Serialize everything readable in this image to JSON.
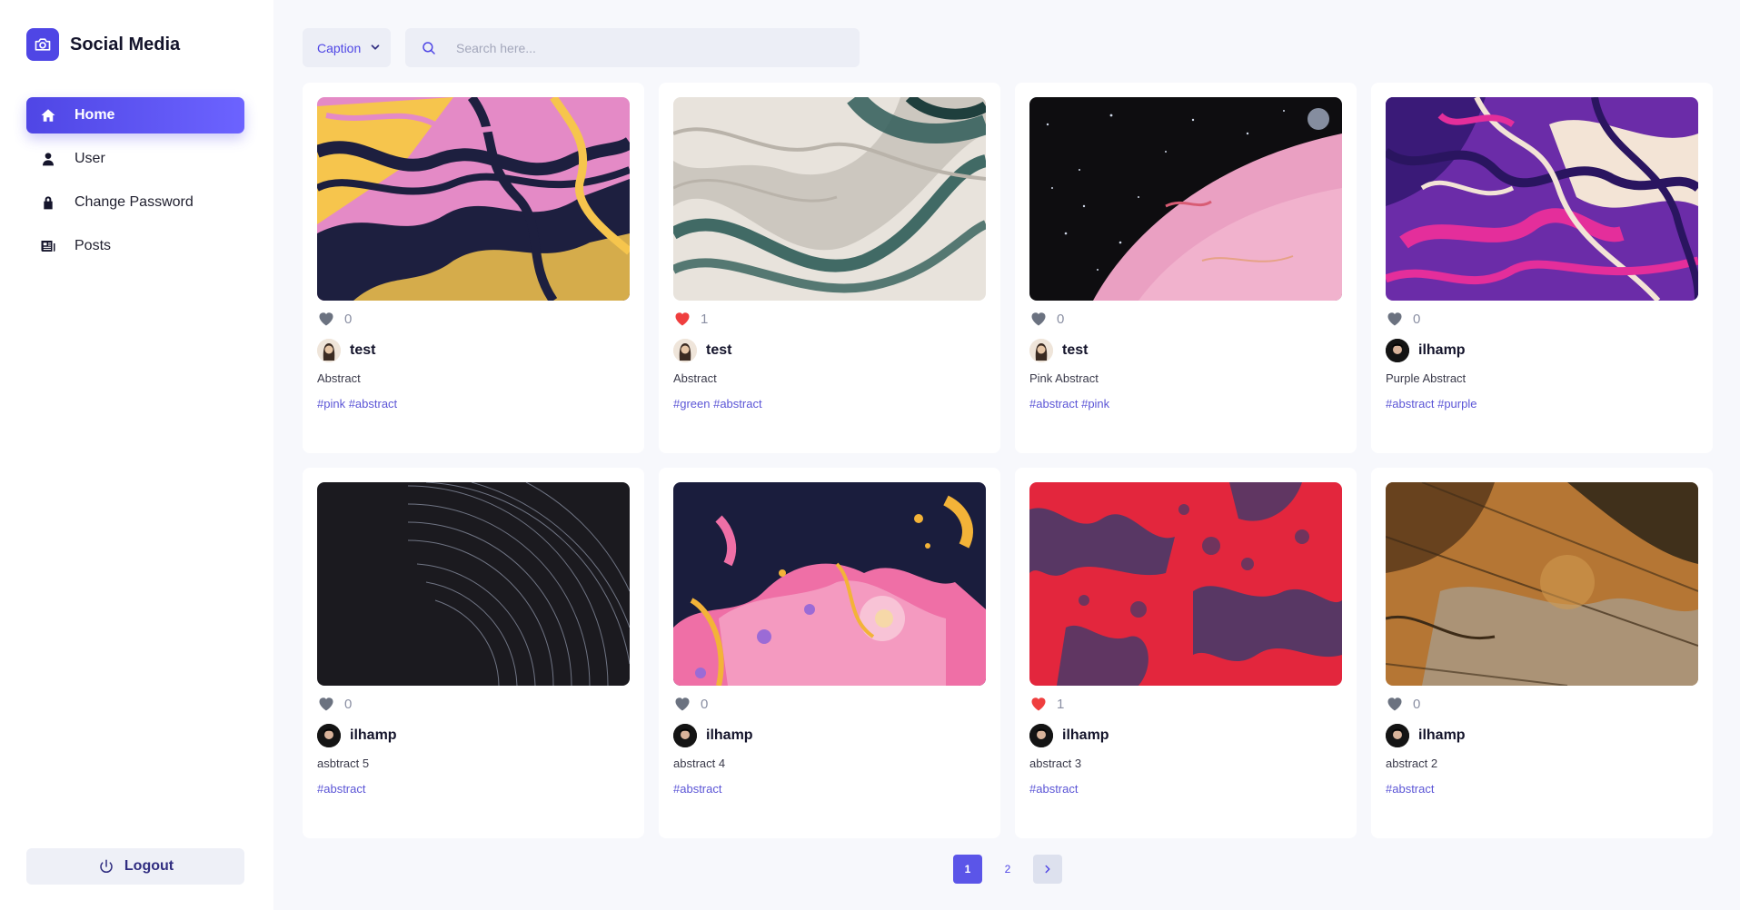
{
  "app": {
    "name": "Social Media",
    "accent": "#4f46e5",
    "logo_icon": "camera-icon"
  },
  "sidebar": {
    "items": [
      {
        "label": "Home",
        "icon": "home-icon",
        "active": true
      },
      {
        "label": "User",
        "icon": "user-icon",
        "active": false
      },
      {
        "label": "Change Password",
        "icon": "lock-icon",
        "active": false
      },
      {
        "label": "Posts",
        "icon": "newspaper-icon",
        "active": false
      }
    ],
    "logout_label": "Logout"
  },
  "toolbar": {
    "filter_selected": "Caption",
    "search_placeholder": "Search here..."
  },
  "posts": [
    {
      "likes": "0",
      "liked": false,
      "author": "test",
      "caption": "Abstract",
      "tags": "#pink #abstract",
      "image": "pink-yellow-marble"
    },
    {
      "likes": "1",
      "liked": true,
      "author": "test",
      "caption": "Abstract",
      "tags": "#green #abstract",
      "image": "green-white-waves"
    },
    {
      "likes": "0",
      "liked": false,
      "author": "test",
      "caption": "Pink Abstract",
      "tags": "#abstract #pink",
      "image": "pink-planet-space"
    },
    {
      "likes": "0",
      "liked": false,
      "author": "ilhamp",
      "caption": "Purple Abstract",
      "tags": "#abstract #purple",
      "image": "purple-splatter"
    },
    {
      "likes": "0",
      "liked": false,
      "author": "ilhamp",
      "caption": "asbtract 5",
      "tags": "#abstract",
      "image": "star-trails"
    },
    {
      "likes": "0",
      "liked": false,
      "author": "ilhamp",
      "caption": "abstract 4",
      "tags": "#abstract",
      "image": "pink-paint-splash"
    },
    {
      "likes": "1",
      "liked": true,
      "author": "ilhamp",
      "caption": "abstract 3",
      "tags": "#abstract",
      "image": "red-navy-texture"
    },
    {
      "likes": "0",
      "liked": false,
      "author": "ilhamp",
      "caption": "abstract 2",
      "tags": "#abstract",
      "image": "rusty-wood-texture"
    }
  ],
  "pagination": {
    "pages": [
      "1",
      "2"
    ],
    "current": "1"
  }
}
